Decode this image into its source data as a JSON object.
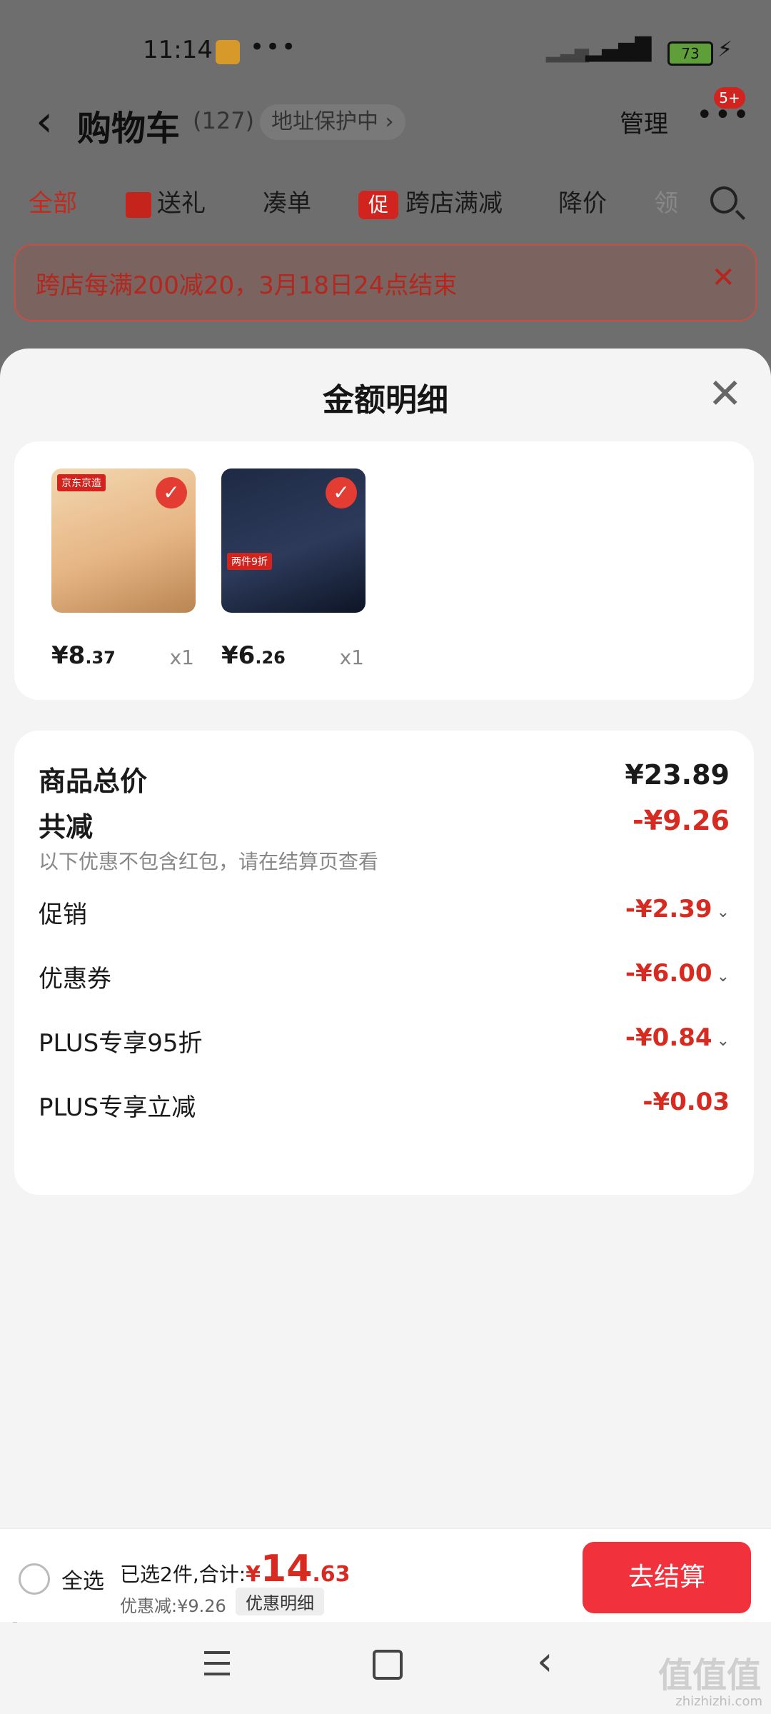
{
  "status_bar": {
    "time": "11:14",
    "dots": "•••",
    "battery": "73"
  },
  "header": {
    "back_icon": "‹",
    "title": "购物车",
    "count": "(127)",
    "address_protect": "地址保护中 ›",
    "manage": "管理",
    "more": "•••",
    "badge": "5+"
  },
  "tabs": {
    "all": "全部",
    "gift": "送礼",
    "bundle": "凑单",
    "promo_tag": "促",
    "cross_store": "跨店满减",
    "price_drop": "降价",
    "partial": "领"
  },
  "promo_banner": {
    "text": "跨店每满200减20，3月18日24点结束",
    "close": "✕"
  },
  "sheet": {
    "title": "金额明细",
    "close": "✕",
    "products": [
      {
        "label": "京东京造",
        "price_main": "¥8",
        "price_dec": ".37",
        "qty": "x1"
      },
      {
        "label": "两件9折",
        "price_main": "¥6",
        "price_dec": ".26",
        "qty": "x1"
      }
    ],
    "breakdown": {
      "total_label": "商品总价",
      "total_value": "¥23.89",
      "reduce_label": "共减",
      "reduce_value": "-¥9.26",
      "hint": "以下优惠不包含红包，请在结算页查看",
      "rows": [
        {
          "label": "促销",
          "value": "-¥2.39"
        },
        {
          "label": "优惠券",
          "value": "-¥6.00"
        },
        {
          "label": "PLUS专享95折",
          "value": "-¥0.84"
        },
        {
          "label": "PLUS专享立减",
          "value": "-¥0.03"
        }
      ]
    }
  },
  "bottom_bar": {
    "select_all": "全选",
    "selected_summary": "已选2件,合计:",
    "total_yen": "¥",
    "total_int": "14",
    "total_dec": ".63",
    "discount": "优惠减:¥9.26",
    "detail": "优惠明细",
    "checkout": "去结算"
  },
  "watermark": {
    "main": "值值值",
    "sub": "zhizhizhi.com"
  },
  "colors": {
    "accent_red": "#d72a20",
    "checkout_bg": "#f1313b"
  }
}
